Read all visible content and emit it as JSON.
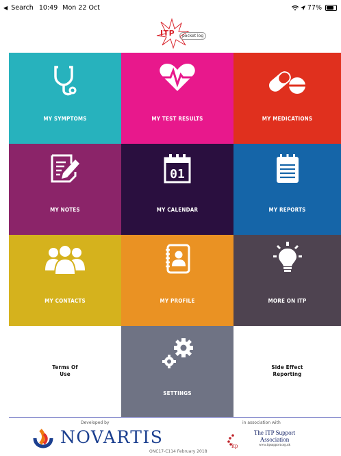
{
  "status_bar": {
    "back_label": "Search",
    "time": "10:49",
    "date": "Mon 22 Oct",
    "battery": "77%",
    "battery_level": 0.77
  },
  "header": {
    "logo_text": "ITP",
    "logo_subtext": "pocket log"
  },
  "tiles": [
    {
      "label": "MY SYMPTOMS",
      "color": "#27b2bd",
      "icon": "stethoscope-icon"
    },
    {
      "label": "MY TEST RESULTS",
      "color": "#e8188c",
      "icon": "heartbeat-icon"
    },
    {
      "label": "MY MEDICATIONS",
      "color": "#e0301e",
      "icon": "pills-icon"
    },
    {
      "label": "MY NOTES",
      "color": "#8b2469",
      "icon": "notes-icon"
    },
    {
      "label": "MY CALENDAR",
      "color": "#2a0f3f",
      "icon": "calendar-icon",
      "icon_text": "01"
    },
    {
      "label": "MY REPORTS",
      "color": "#1565a8",
      "icon": "report-icon"
    },
    {
      "label": "MY CONTACTS",
      "color": "#d5b21d",
      "icon": "contacts-icon"
    },
    {
      "label": "MY PROFILE",
      "color": "#ea9223",
      "icon": "profile-icon"
    },
    {
      "label": "MORE ON ITP",
      "color": "#4e4350",
      "icon": "lightbulb-icon"
    },
    {
      "label": "Terms Of\nUse",
      "color": "#ffffff"
    },
    {
      "label": "SETTINGS",
      "color": "#6f7384",
      "icon": "gears-icon"
    },
    {
      "label": "Side Effect\nReporting",
      "color": "#ffffff"
    }
  ],
  "footer": {
    "developed_by": "Developed by",
    "novartis": "NOVARTIS",
    "in_association": "in association with",
    "itp_line1": "The ITP Support",
    "itp_line2": "Association",
    "itp_url": "www.itpsupport.org.uk",
    "itp_badge": "itp",
    "code": "ONC17-C114 February 2018"
  }
}
